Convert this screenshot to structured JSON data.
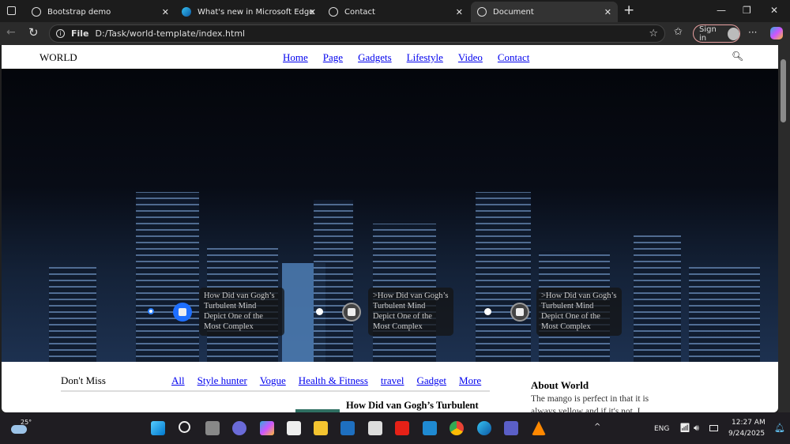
{
  "browser": {
    "tabs": [
      {
        "title": "Bootstrap demo",
        "icon": "globe-icon"
      },
      {
        "title": "What's new in Microsoft Edge",
        "icon": "edge-icon"
      },
      {
        "title": "Contact",
        "icon": "globe-icon"
      },
      {
        "title": "Document",
        "icon": "globe-icon",
        "active": true
      }
    ],
    "url_prefix": "File",
    "url": "D:/Task/world-template/index.html",
    "signin": "Sign in"
  },
  "site": {
    "logo": "WORLD",
    "nav": [
      "Home",
      "Page",
      "Gadgets",
      "Lifestyle",
      "Video",
      "Contact"
    ],
    "hero_cards": [
      "How Did van Gogh’s Turbulent Mind Depict One of the Most Complex",
      ">How Did van Gogh’s Turbulent Mind Depict One of the Most Complex",
      ">How Did van Gogh’s Turbulent Mind Depict One of the Most Complex"
    ],
    "dont_miss": "Don't Miss",
    "categories": [
      "All",
      "Style hunter",
      "Vogue",
      "Health & Fitness",
      "travel",
      "Gadget",
      "More"
    ],
    "article_title": "How Did van Gogh’s Turbulent",
    "about_title": "About World",
    "about_text": "The mango is perfect in that it is always yellow and if it's not, I don't"
  },
  "taskbar": {
    "weather": "25°",
    "lang": "ENG",
    "time": "12:27 AM",
    "date": "9/24/2025"
  }
}
